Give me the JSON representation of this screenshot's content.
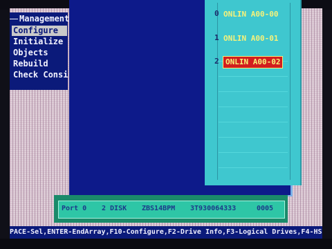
{
  "menu": {
    "title": "Management",
    "items": [
      {
        "label": "Configure",
        "selected": true
      },
      {
        "label": "Initialize",
        "selected": false
      },
      {
        "label": "Objects",
        "selected": false
      },
      {
        "label": "Rebuild",
        "selected": false
      },
      {
        "label": "Check Consis",
        "selected": false
      }
    ]
  },
  "drives": [
    {
      "number": "0",
      "label": "ONLIN A00-00",
      "selected": false
    },
    {
      "number": "1",
      "label": "ONLIN A00-01",
      "selected": false
    },
    {
      "number": "2",
      "label": "ONLIN A00-02",
      "selected": true
    }
  ],
  "info_bar": {
    "port": "Port 0",
    "disk": "2 DISK",
    "model": "ZBS14BPM",
    "serial": "3T930064333",
    "value": "0005"
  },
  "status_bar": {
    "text": "PACE-Sel,ENTER-EndArray,F10-Configure,F2-Drive Info,F3-Logical Drives,F4-HS"
  },
  "colors": {
    "window_blue": "#0d1a8a",
    "drive_cyan": "#3fc7cf",
    "selected_red": "#d21e1e",
    "label_yellow": "#f6f27a",
    "info_green": "#2ec6a6"
  }
}
